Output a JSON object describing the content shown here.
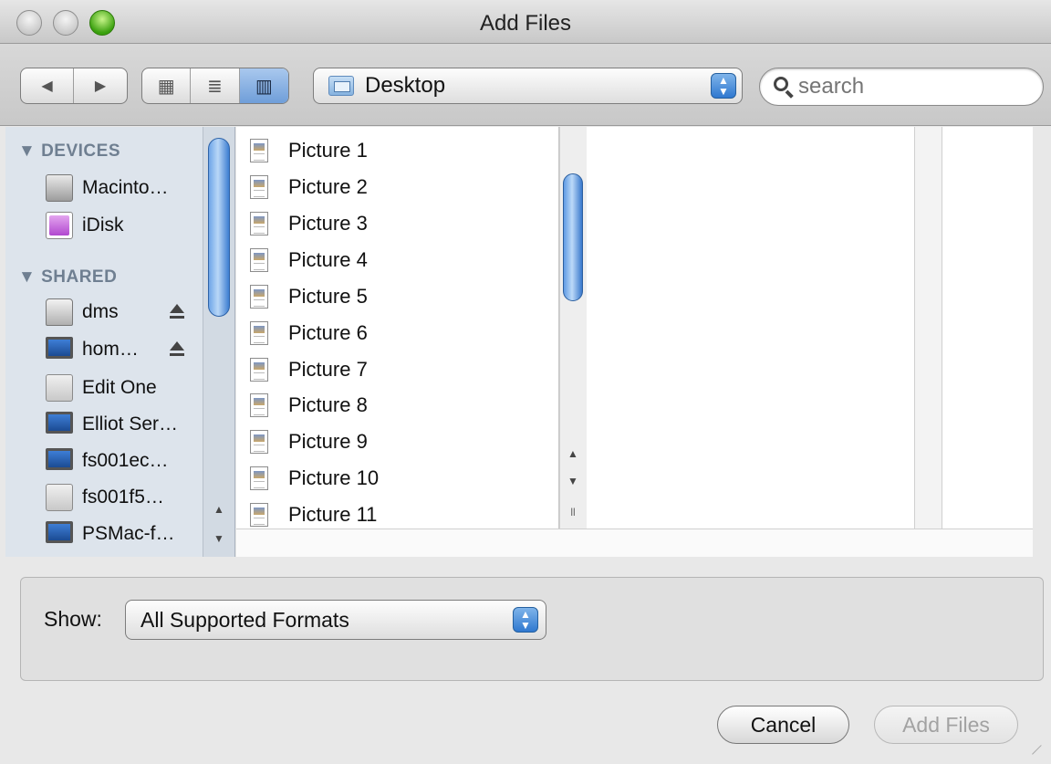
{
  "window": {
    "title": "Add Files"
  },
  "toolbar": {
    "back_icon": "◀",
    "forward_icon": "▶",
    "icon_view_glyph": "▦",
    "list_view_glyph": "≣",
    "column_view_glyph": "▥",
    "active_view": "column",
    "location": "Desktop",
    "search_placeholder": "search"
  },
  "sidebar": {
    "sections": [
      {
        "title": "▼ DEVICES"
      },
      {
        "title": "▼ SHARED"
      }
    ],
    "devices": [
      {
        "label": "Macinto…",
        "icon": "hard-drive-icon"
      },
      {
        "label": "iDisk",
        "icon": "idisk-icon"
      }
    ],
    "shared": [
      {
        "label": "dms",
        "icon": "server-icon",
        "ejectable": true
      },
      {
        "label": "hom…",
        "icon": "monitor-icon",
        "ejectable": true
      },
      {
        "label": "Edit One",
        "icon": "generic-computer-icon",
        "ejectable": false
      },
      {
        "label": "Elliot Ser…",
        "icon": "monitor-icon",
        "ejectable": false
      },
      {
        "label": "fs001ec…",
        "icon": "monitor-icon",
        "ejectable": false
      },
      {
        "label": "fs001f5…",
        "icon": "generic-computer-icon",
        "ejectable": false
      },
      {
        "label": "PSMac-f…",
        "icon": "monitor-icon",
        "ejectable": false
      }
    ]
  },
  "files": [
    "Picture 1",
    "Picture 2",
    "Picture 3",
    "Picture 4",
    "Picture 5",
    "Picture 6",
    "Picture 7",
    "Picture 8",
    "Picture 9",
    "Picture 10",
    "Picture 11"
  ],
  "options": {
    "show_label": "Show:",
    "format": "All Supported Formats"
  },
  "buttons": {
    "cancel": "Cancel",
    "add": "Add Files"
  },
  "colors": {
    "selection_blue": "#3d7ed1",
    "sidebar_bg": "#dde4ec",
    "zoom_green": "#3aa00e"
  }
}
